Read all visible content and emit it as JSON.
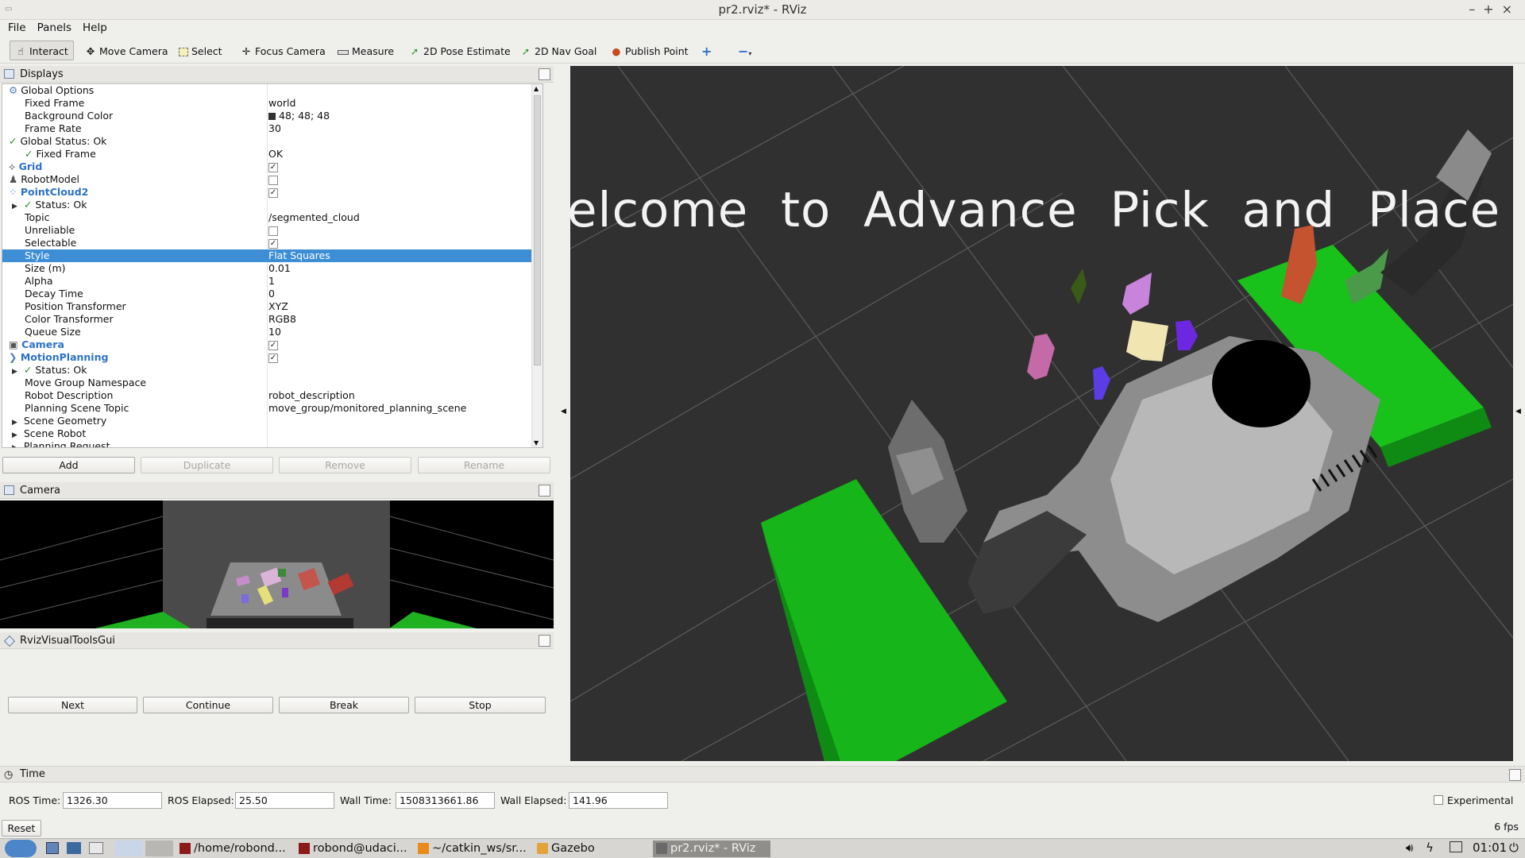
{
  "window": {
    "title": "pr2.rviz* - RViz",
    "app_icon": "rviz-icon",
    "min": "–",
    "max": "+",
    "close": "×"
  },
  "menu": [
    "File",
    "Panels",
    "Help"
  ],
  "toolbar": {
    "interact": "Interact",
    "move_camera": "Move Camera",
    "select": "Select",
    "focus_camera": "Focus Camera",
    "measure": "Measure",
    "pose_estimate": "2D Pose Estimate",
    "nav_goal": "2D Nav Goal",
    "publish_point": "Publish Point",
    "add_tool": "+",
    "remove_tool": "−"
  },
  "displays": {
    "title": "Displays",
    "rows": [
      {
        "key": "Global Options",
        "value": ""
      },
      {
        "key": "Fixed Frame",
        "value": "world"
      },
      {
        "key": "Background Color",
        "value": "48; 48; 48"
      },
      {
        "key": "Frame Rate",
        "value": "30"
      },
      {
        "key": "Global Status: Ok",
        "value": ""
      },
      {
        "key": "Fixed Frame",
        "value": "OK"
      },
      {
        "key": "Grid",
        "value": ""
      },
      {
        "key": "RobotModel",
        "value": ""
      },
      {
        "key": "PointCloud2",
        "value": ""
      },
      {
        "key": "Status: Ok",
        "value": ""
      },
      {
        "key": "Topic",
        "value": "/segmented_cloud"
      },
      {
        "key": "Unreliable",
        "value": ""
      },
      {
        "key": "Selectable",
        "value": ""
      },
      {
        "key": "Style",
        "value": "Flat Squares"
      },
      {
        "key": "Size (m)",
        "value": "0.01"
      },
      {
        "key": "Alpha",
        "value": "1"
      },
      {
        "key": "Decay Time",
        "value": "0"
      },
      {
        "key": "Position Transformer",
        "value": "XYZ"
      },
      {
        "key": "Color Transformer",
        "value": "RGB8"
      },
      {
        "key": "Queue Size",
        "value": "10"
      },
      {
        "key": "Camera",
        "value": ""
      },
      {
        "key": "MotionPlanning",
        "value": ""
      },
      {
        "key": "Status: Ok",
        "value": ""
      },
      {
        "key": "Move Group Namespace",
        "value": ""
      },
      {
        "key": "Robot Description",
        "value": "robot_description"
      },
      {
        "key": "Planning Scene Topic",
        "value": "move_group/monitored_planning_scene"
      },
      {
        "key": "Scene Geometry",
        "value": ""
      },
      {
        "key": "Scene Robot",
        "value": ""
      },
      {
        "key": "Planning Request",
        "value": ""
      }
    ],
    "buttons": {
      "add": "Add",
      "duplicate": "Duplicate",
      "remove": "Remove",
      "rename": "Rename"
    }
  },
  "camera_panel": {
    "title": "Camera"
  },
  "visual_tools": {
    "title": "RvizVisualToolsGui",
    "buttons": {
      "next": "Next",
      "continue": "Continue",
      "break": "Break",
      "stop": "Stop"
    }
  },
  "view3d": {
    "banner_text": "elcome  to  Advance  Pick  and  Place",
    "background": "#303030"
  },
  "time_panel": {
    "title": "Time",
    "ros_time_label": "ROS Time:",
    "ros_time": "1326.30",
    "ros_elapsed_label": "ROS Elapsed:",
    "ros_elapsed": "25.50",
    "wall_time_label": "Wall Time:",
    "wall_time": "1508313661.86",
    "wall_elapsed_label": "Wall Elapsed:",
    "wall_elapsed": "141.96",
    "experimental": "Experimental",
    "reset": "Reset",
    "fps": "6 fps"
  },
  "taskbar": {
    "tasks": [
      "/home/robond...",
      "robond@udaci...",
      "~/catkin_ws/sr...",
      "Gazebo",
      "pr2.rviz* - RViz"
    ],
    "clock": "01:01"
  },
  "colors": {
    "accent": "#3d8ed5",
    "blue_text": "#2d72c7",
    "table_green": "#19c11b"
  }
}
